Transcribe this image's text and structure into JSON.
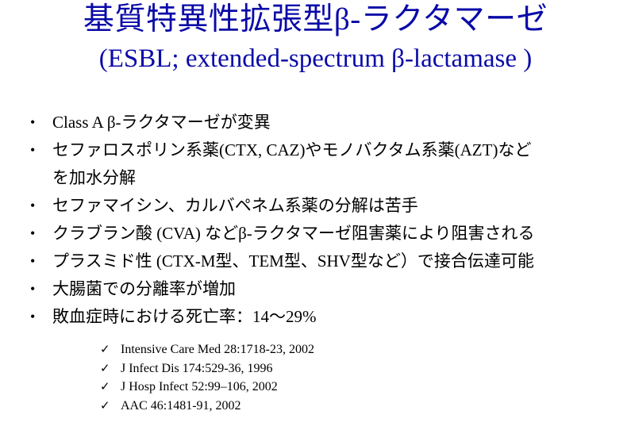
{
  "title": {
    "line1": "基質特異性拡張型β-ラクタマーゼ",
    "line2": "(ESBL; extended-spectrum β-lactamase )"
  },
  "bullets": [
    {
      "text": "Class A β-ラクタマーゼが変異",
      "cont": ""
    },
    {
      "text": "セファロスポリン系薬(CTX, CAZ)やモノバクタム系薬(AZT)など",
      "cont": "を加水分解"
    },
    {
      "text": "セファマイシン、カルバペネム系薬の分解は苦手",
      "cont": ""
    },
    {
      "text": "クラブラン酸 (CVA) などβ-ラクタマーゼ阻害薬により阻害される",
      "cont": ""
    },
    {
      "text": "プラスミド性 (CTX-M型、TEM型、SHV型など）で接合伝達可能",
      "cont": ""
    },
    {
      "text": "大腸菌での分離率が増加",
      "cont": ""
    },
    {
      "text": "敗血症時における死亡率：14〜29%",
      "cont": ""
    }
  ],
  "references": [
    "Intensive Care Med 28:1718-23, 2002",
    "J Infect Dis 174:529-36, 1996",
    "J Hosp Infect 52:99–106, 2002",
    "AAC 46:1481-91, 2002"
  ],
  "colors": {
    "title": "#0a0aa8",
    "body_text": "#000000",
    "background": "#ffffff"
  },
  "icons": {
    "bullet": "•",
    "reference_marker": "✓"
  }
}
